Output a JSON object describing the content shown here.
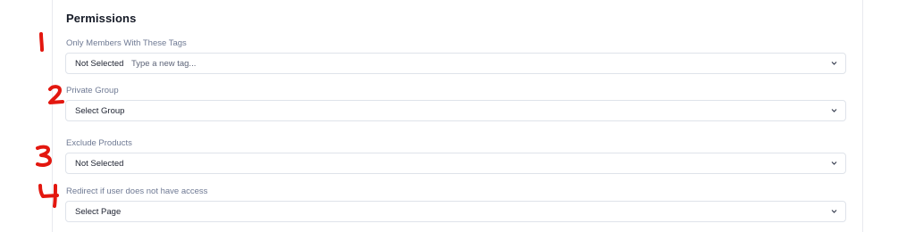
{
  "section": {
    "title": "Permissions"
  },
  "fields": [
    {
      "label": "Only Members With These Tags",
      "value": "Not Selected",
      "placeholder": "Type a new tag..."
    },
    {
      "label": "Private Group",
      "value": "Select Group"
    },
    {
      "label": "Exclude Products",
      "value": "Not Selected"
    },
    {
      "label": "Redirect if user does not have access",
      "value": "Select Page"
    }
  ],
  "annotations": [
    "1",
    "2",
    "3",
    "4"
  ],
  "colors": {
    "annotation": "#e3170f",
    "label": "#6f7a94",
    "border": "#dfe3ea",
    "title": "#151a26"
  }
}
